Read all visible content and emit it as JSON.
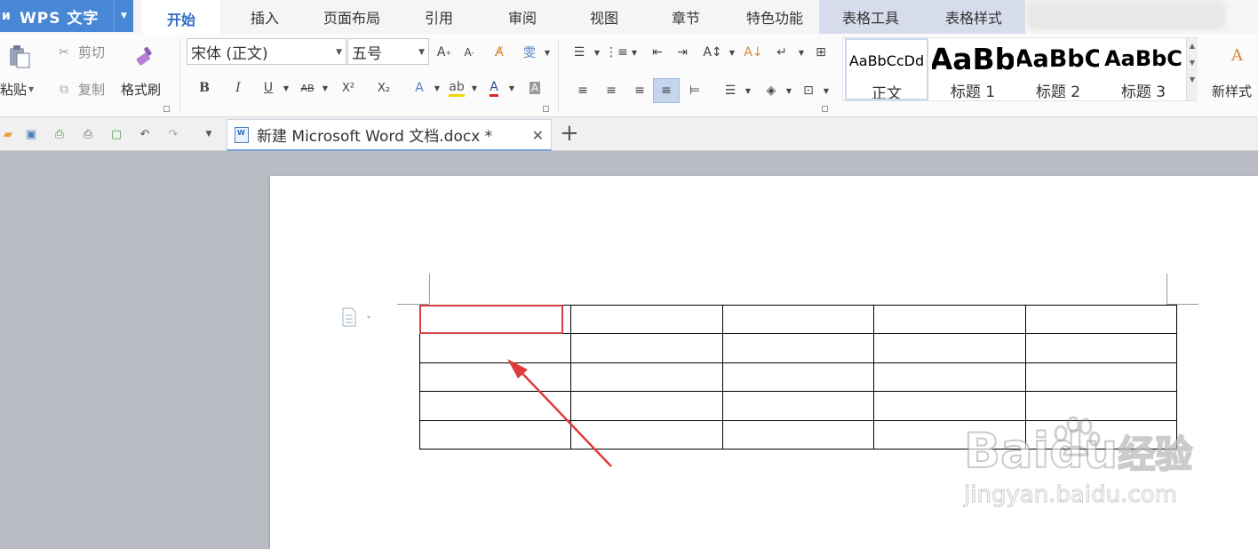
{
  "app": {
    "logo_label": "WPS 文字"
  },
  "menu_tabs": [
    {
      "label": "开始"
    },
    {
      "label": "插入"
    },
    {
      "label": "页面布局"
    },
    {
      "label": "引用"
    },
    {
      "label": "审阅"
    },
    {
      "label": "视图"
    },
    {
      "label": "章节"
    },
    {
      "label": "特色功能"
    },
    {
      "label": "表格工具"
    },
    {
      "label": "表格样式"
    }
  ],
  "ribbon": {
    "paste_label": "粘贴",
    "cut_label": "剪切",
    "copy_label": "复制",
    "format_painter_label": "格式刷",
    "font_name": "宋体 (正文)",
    "font_size": "五号",
    "new_style_label": "新样式",
    "styles": [
      {
        "sample": "AaBbCcDd",
        "name": "正文"
      },
      {
        "sample": "AaBb",
        "name": "标题 1"
      },
      {
        "sample": "AaBbC",
        "name": "标题 2"
      },
      {
        "sample": "AaBbC",
        "name": "标题 3"
      }
    ],
    "bold": "B",
    "italic": "I",
    "underline": "U",
    "strike": "AB",
    "superscript": "X²",
    "subscript": "X₂"
  },
  "document": {
    "tab_name": "新建 Microsoft Word 文档.docx *",
    "table": {
      "rows": 5,
      "cols": 5,
      "cells": [
        [
          "",
          "",
          "",
          "",
          ""
        ],
        [
          "",
          "",
          "",
          "",
          ""
        ],
        [
          "",
          "",
          "",
          "",
          ""
        ],
        [
          "",
          "",
          "",
          "",
          ""
        ],
        [
          "",
          "",
          "",
          "",
          ""
        ]
      ]
    }
  },
  "watermark": {
    "brand": "Baidu",
    "suffix": "经验",
    "url": "jingyan.baidu.com"
  },
  "colors": {
    "wps_blue": "#4787d6",
    "active_tab_text": "#2e6bc6",
    "context_tab_bg": "#d7dcec",
    "selection_red": "#d44040"
  }
}
